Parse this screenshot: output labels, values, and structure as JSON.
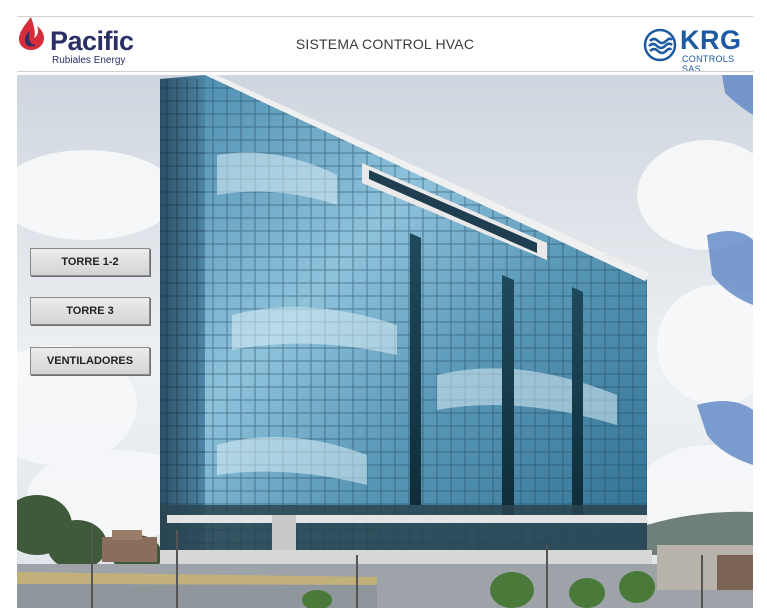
{
  "header": {
    "title": "SISTEMA CONTROL HVAC",
    "left_logo": {
      "name": "Pacific",
      "subtitle": "Rubiales Energy",
      "icon": "flame-drop-icon",
      "color": "#2a2f66",
      "accent": "#d62d3a"
    },
    "right_logo": {
      "name": "KRG",
      "subtitle": "CONTROLS SAS",
      "icon": "wave-circle-icon",
      "color": "#1e5aa0"
    }
  },
  "scene": {
    "description_icon": "office-tower-photo",
    "sign": "Pacific"
  },
  "nav": {
    "buttons": [
      {
        "label": "TORRE 1-2"
      },
      {
        "label": "TORRE 3"
      },
      {
        "label": "VENTILADORES"
      }
    ]
  }
}
